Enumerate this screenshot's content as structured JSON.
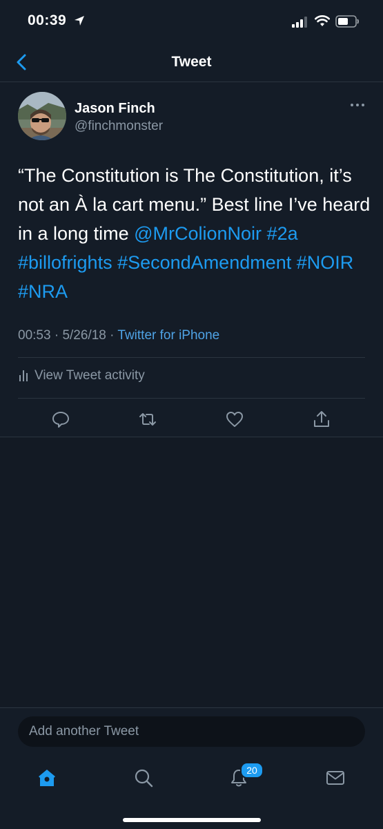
{
  "status_bar": {
    "time": "00:39"
  },
  "nav": {
    "title": "Tweet"
  },
  "tweet": {
    "author_name": "Jason Finch",
    "author_handle": "@finchmonster",
    "text_plain": "“The Constitution is The Constitution, it’s not an À la cart menu.”  Best line I’ve heard in a long time ",
    "mention": "@MrColionNoir",
    "hashtags": [
      "#2a",
      "#billofrights",
      "#SecondAmendment",
      "#NOIR",
      "#NRA"
    ],
    "time": "00:53",
    "date": "5/26/18",
    "source": "Twitter for iPhone",
    "separator": "·",
    "activity_label": "View Tweet activity"
  },
  "compose": {
    "placeholder": "Add another Tweet"
  },
  "tabbar": {
    "notifications_badge": "20"
  },
  "colors": {
    "background": "#141c27",
    "accent": "#1d9bf0",
    "secondary_text": "#8b98a5"
  }
}
